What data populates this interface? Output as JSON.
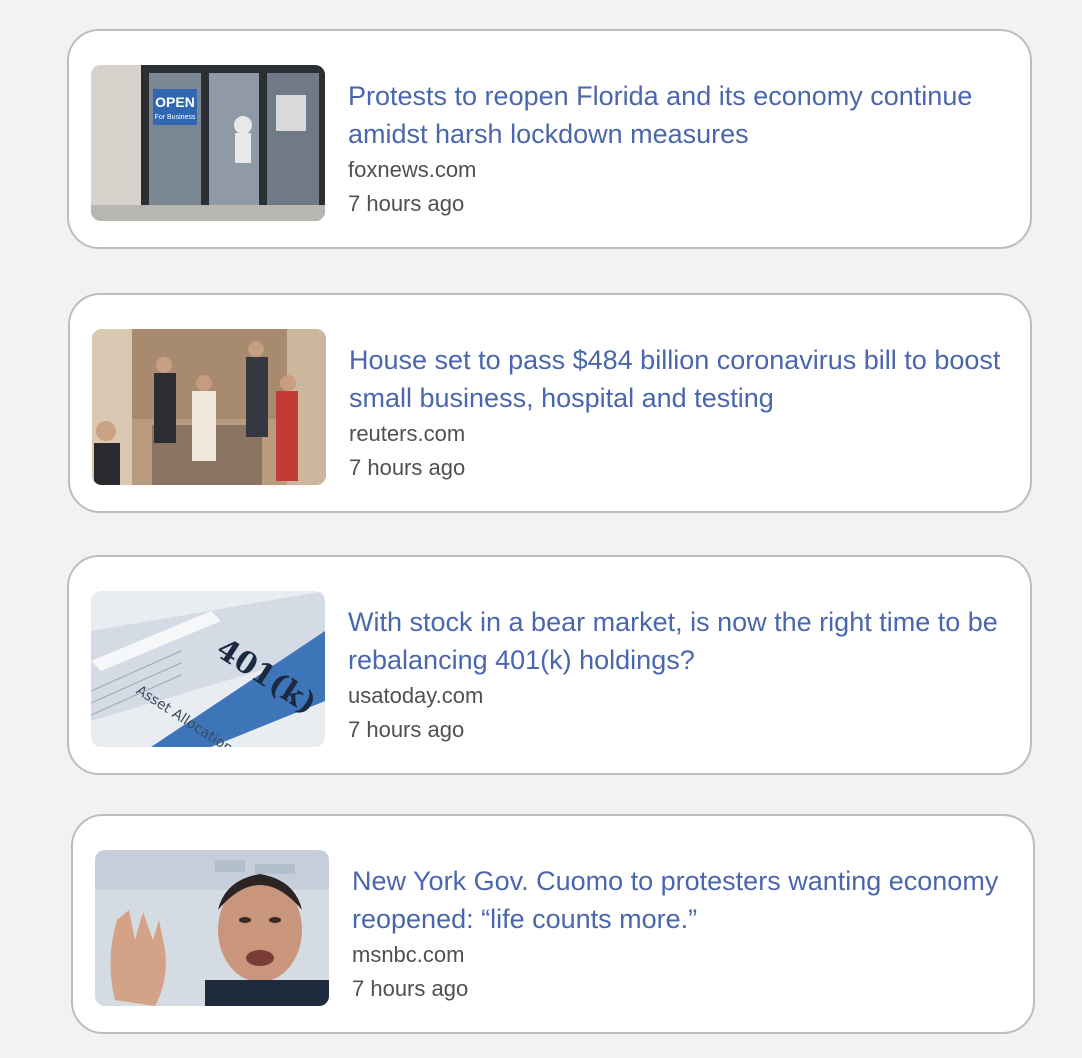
{
  "articles": [
    {
      "headline": "Protests to reopen Florida and its economy continue amidst harsh lockdown measures",
      "source": "foxnews.com",
      "time": "7 hours ago",
      "thumb_sign_line1": "OPEN",
      "thumb_sign_line2": "For Business"
    },
    {
      "headline": "House set to pass $484 billion coronavirus bill to boost small business, hospital and testing",
      "source": "reuters.com",
      "time": "7 hours ago"
    },
    {
      "headline": "With stock in a bear market, is now the right time to be rebalancing 401(k) holdings?",
      "source": "usatoday.com",
      "time": "7 hours ago",
      "thumb_form_label": "401(k)",
      "thumb_form_sublabel": "Asset Allocation"
    },
    {
      "headline": "New York Gov. Cuomo to protesters wanting economy reopened: “life counts more.”",
      "source": "msnbc.com",
      "time": "7 hours ago"
    }
  ]
}
